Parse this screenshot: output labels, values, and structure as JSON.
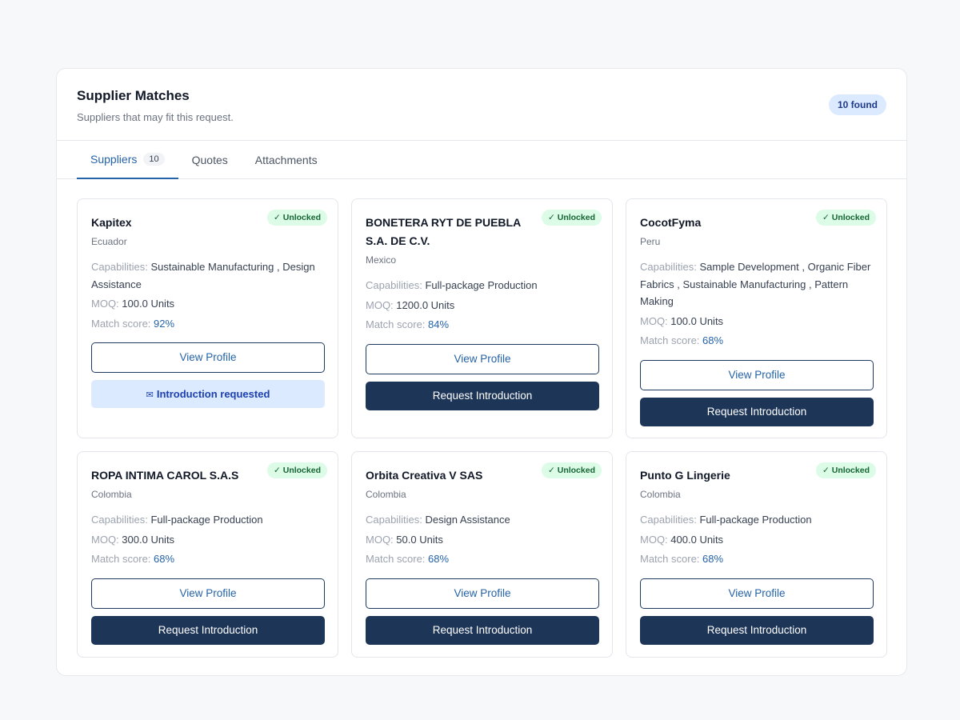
{
  "header": {
    "title": "Supplier Matches",
    "subtitle": "Suppliers that may fit this request.",
    "found_badge": "10 found"
  },
  "tabs": [
    {
      "label": "Suppliers",
      "count": "10",
      "active": true
    },
    {
      "label": "Quotes"
    },
    {
      "label": "Attachments"
    }
  ],
  "labels": {
    "capabilities": "Capabilities:",
    "moq": "MOQ:",
    "match_score": "Match score:",
    "view_profile": "View Profile",
    "request_intro": "Request Introduction",
    "intro_requested": "Introduction requested",
    "unlocked": "✓ Unlocked"
  },
  "suppliers": [
    {
      "name": "Kapitex",
      "country": "Ecuador",
      "capabilities": "Sustainable Manufacturing , Design Assistance",
      "moq": "100.0 Units",
      "match_score": "92%",
      "intro_requested": true
    },
    {
      "name": "BONETERA RYT DE PUEBLA S.A. DE C.V.",
      "country": "Mexico",
      "capabilities": "Full-package Production",
      "moq": "1200.0 Units",
      "match_score": "84%",
      "intro_requested": false
    },
    {
      "name": "CocotFyma",
      "country": "Peru",
      "capabilities": "Sample Development , Organic Fiber Fabrics , Sustainable Manufacturing , Pattern Making",
      "moq": "100.0 Units",
      "match_score": "68%",
      "intro_requested": false
    },
    {
      "name": "ROPA INTIMA CAROL S.A.S",
      "country": "Colombia",
      "capabilities": "Full-package Production",
      "moq": "300.0 Units",
      "match_score": "68%",
      "intro_requested": false
    },
    {
      "name": "Orbita Creativa V SAS",
      "country": "Colombia",
      "capabilities": "Design Assistance",
      "moq": "50.0 Units",
      "match_score": "68%",
      "intro_requested": false
    },
    {
      "name": "Punto G Lingerie",
      "country": "Colombia",
      "capabilities": "Full-package Production",
      "moq": "400.0 Units",
      "match_score": "68%",
      "intro_requested": false
    }
  ],
  "colors": {
    "accent": "#2563a8",
    "primary_button": "#1d3557",
    "unlocked_bg": "#dcfce7",
    "unlocked_text": "#166534"
  }
}
